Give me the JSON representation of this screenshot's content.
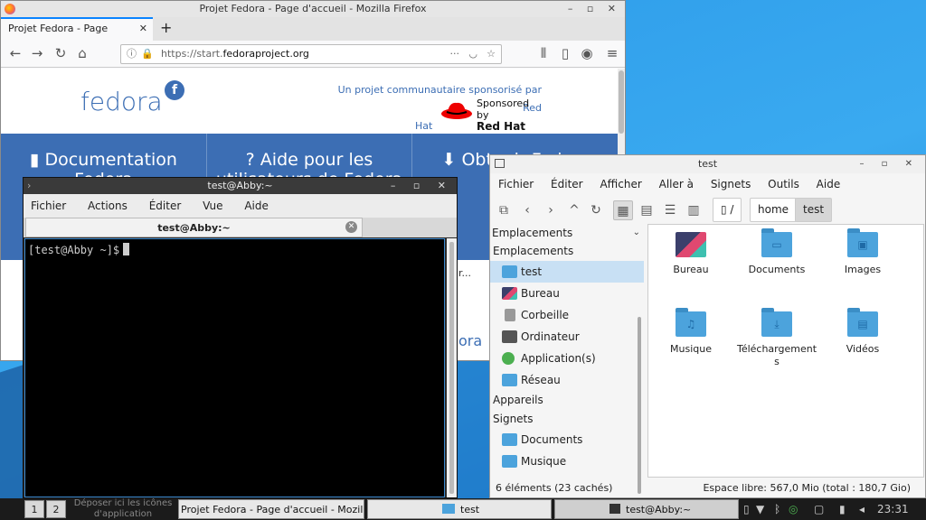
{
  "firefox": {
    "window_title": "Projet Fedora - Page d'accueil - Mozilla Firefox",
    "tab_label": "Projet Fedora - Page d'accueil",
    "url_prefix": "https://start.",
    "url_domain": "fedoraproject.org",
    "logo_text": "fedora",
    "sponsor_line1": "Un projet communautaire sponsorisé par Red",
    "sponsor_line2": "Hat",
    "sponsored_by": "Sponsored by",
    "redhat": "Red Hat",
    "nav": [
      {
        "label": "Documentation Fedora",
        "icon": "book-icon"
      },
      {
        "label": "Aide pour les utilisateurs de Fedora",
        "icon": "help-icon"
      },
      {
        "label": "Obtenir Fedora",
        "icon": "download-icon"
      }
    ],
    "partial_text_1": "r...",
    "partial_text_2": "ora"
  },
  "terminal": {
    "window_title": "test@Abby:~",
    "menu": [
      "Fichier",
      "Actions",
      "Éditer",
      "Vue",
      "Aide"
    ],
    "tab_label": "test@Abby:~",
    "prompt": "[test@Abby ~]$"
  },
  "filemanager": {
    "window_title": "test",
    "menu": [
      "Fichier",
      "Éditer",
      "Afficher",
      "Aller à",
      "Signets",
      "Outils",
      "Aide"
    ],
    "crumbs": [
      "/",
      "home",
      "test"
    ],
    "side_dropdown": "Emplacements",
    "sections": {
      "places": "Emplacements",
      "devices": "Appareils",
      "bookmarks": "Signets"
    },
    "places": [
      "test",
      "Bureau",
      "Corbeille",
      "Ordinateur",
      "Application(s)",
      "Réseau"
    ],
    "bookmarks": [
      "Documents",
      "Musique"
    ],
    "items": [
      {
        "label": "Bureau",
        "icon": "desktop-folder-icon"
      },
      {
        "label": "Documents",
        "icon": "documents-folder-icon"
      },
      {
        "label": "Images",
        "icon": "images-folder-icon"
      },
      {
        "label": "Musique",
        "icon": "music-folder-icon"
      },
      {
        "label": "Téléchargements",
        "icon": "downloads-folder-icon"
      },
      {
        "label": "Vidéos",
        "icon": "videos-folder-icon"
      }
    ],
    "status_left": "6 éléments (23 cachés)",
    "status_right": "Espace libre: 567,0 Mio (total : 180,7 Gio)"
  },
  "taskbar": {
    "workspaces": [
      "1",
      "2"
    ],
    "launcher_hint": "Déposer ici les icônes d'application",
    "tasks": [
      "Projet Fedora - Page d'accueil - Mozilla Firefox",
      "test",
      "test@Abby:~"
    ],
    "clock": "23:31"
  },
  "colors": {
    "fedora_blue": "#3c6eb4",
    "selection": "#c8e0f4",
    "folder": "#4ca3dc"
  }
}
